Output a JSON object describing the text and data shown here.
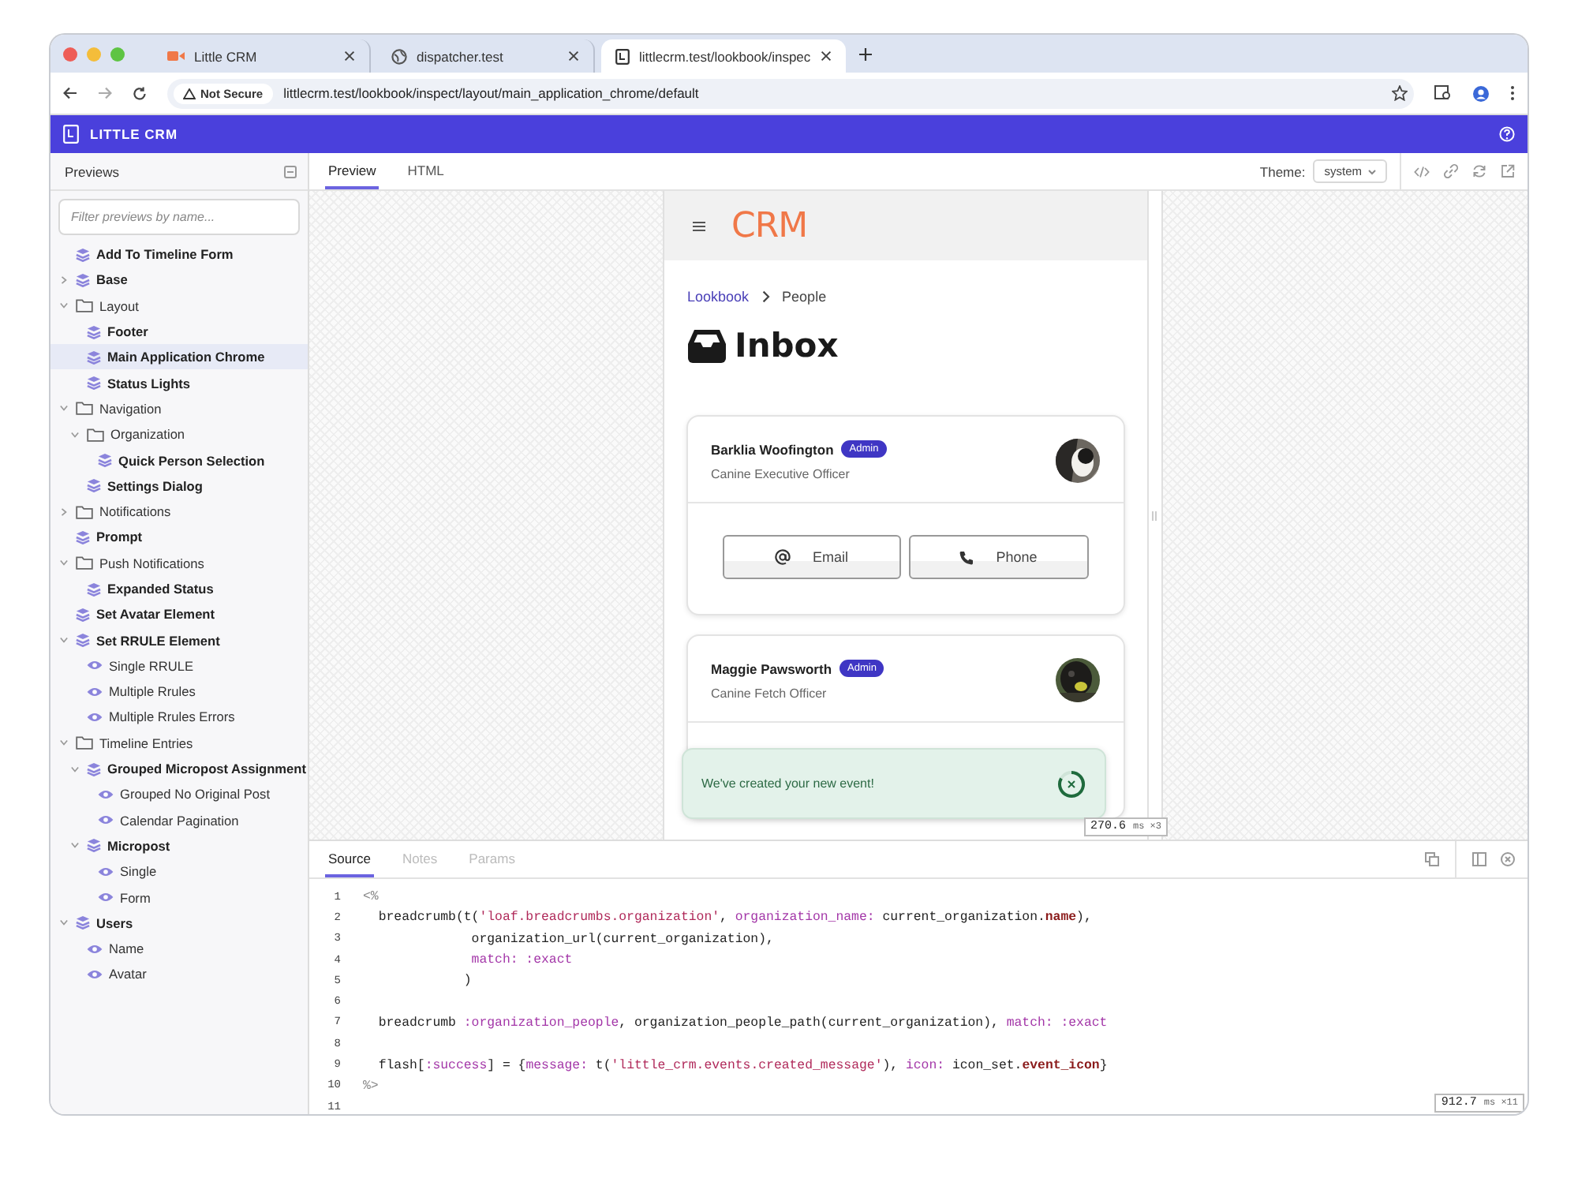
{
  "browser": {
    "tabs": [
      {
        "title": "Little CRM",
        "selected": false
      },
      {
        "title": "dispatcher.test",
        "selected": false
      },
      {
        "title": "littlecrm.test/lookbook/inspec",
        "selected": true
      }
    ],
    "security": "Not Secure",
    "url": "littlecrm.test/lookbook/inspect/layout/main_application_chrome/default"
  },
  "app_header": {
    "title": "LITTLE CRM"
  },
  "sidebar": {
    "title": "Previews",
    "filter": {
      "placeholder": "Filter previews by name..."
    },
    "items": [
      {
        "label": "Add To Timeline Form",
        "kind": "component",
        "selected": false
      },
      {
        "label": "Base",
        "kind": "component",
        "selected": false,
        "expanded": false
      },
      {
        "label": "Layout",
        "kind": "folder",
        "selected": false,
        "expanded": true,
        "children": [
          {
            "label": "Footer",
            "kind": "component",
            "selected": false
          },
          {
            "label": "Main Application Chrome",
            "kind": "component",
            "selected": true
          },
          {
            "label": "Status Lights",
            "kind": "component",
            "selected": false
          }
        ]
      },
      {
        "label": "Navigation",
        "kind": "folder",
        "selected": false,
        "expanded": true,
        "children": [
          {
            "label": "Organization",
            "kind": "folder",
            "selected": false,
            "expanded": true,
            "children": [
              {
                "label": "Quick Person Selection",
                "kind": "component",
                "selected": false
              }
            ]
          },
          {
            "label": "Settings Dialog",
            "kind": "component",
            "selected": false
          }
        ]
      },
      {
        "label": "Notifications",
        "kind": "folder",
        "selected": false,
        "expanded": false
      },
      {
        "label": "Prompt",
        "kind": "component",
        "selected": false
      },
      {
        "label": "Push Notifications",
        "kind": "folder",
        "selected": false,
        "expanded": true,
        "children": [
          {
            "label": "Expanded Status",
            "kind": "component",
            "selected": false
          }
        ]
      },
      {
        "label": "Set Avatar Element",
        "kind": "component",
        "selected": false
      },
      {
        "label": "Set RRULE Element",
        "kind": "component",
        "selected": false,
        "expanded": true,
        "children": [
          {
            "label": "Single RRULE",
            "kind": "preview",
            "selected": false
          },
          {
            "label": "Multiple Rrules",
            "kind": "preview",
            "selected": false
          },
          {
            "label": "Multiple Rrules Errors",
            "kind": "preview",
            "selected": false
          }
        ]
      },
      {
        "label": "Timeline Entries",
        "kind": "folder",
        "selected": false,
        "expanded": true,
        "children": [
          {
            "label": "Grouped Micropost Assignment",
            "kind": "component",
            "selected": false,
            "expanded": true,
            "children": [
              {
                "label": "Grouped No Original Post",
                "kind": "preview",
                "selected": false
              },
              {
                "label": "Calendar Pagination",
                "kind": "preview",
                "selected": false
              }
            ]
          },
          {
            "label": "Micropost",
            "kind": "component",
            "selected": false,
            "expanded": true,
            "children": [
              {
                "label": "Single",
                "kind": "preview",
                "selected": false
              },
              {
                "label": "Form",
                "kind": "preview",
                "selected": false
              }
            ]
          }
        ]
      },
      {
        "label": "Users",
        "kind": "component",
        "selected": false,
        "expanded": true,
        "children": [
          {
            "label": "Name",
            "kind": "preview",
            "selected": false
          },
          {
            "label": "Avatar",
            "kind": "preview",
            "selected": false
          }
        ]
      }
    ]
  },
  "preview_toolbar": {
    "tabs": [
      {
        "label": "Preview",
        "selected": true
      },
      {
        "label": "HTML",
        "selected": false
      }
    ],
    "theme_label": "Theme:",
    "theme_value": "system"
  },
  "preview": {
    "logo": "CRM",
    "breadcrumbs": [
      {
        "label": "Lookbook",
        "kind": "link"
      },
      {
        "label": "People",
        "kind": "current"
      }
    ],
    "heading": "Inbox",
    "people": [
      {
        "name": "Barklia Woofington",
        "badge": "Admin",
        "title": "Canine Executive Officer",
        "buttons": [
          {
            "label": "Email"
          },
          {
            "label": "Phone"
          }
        ]
      },
      {
        "name": "Maggie Pawsworth",
        "badge": "Admin",
        "title": "Canine Fetch Officer"
      }
    ],
    "toast": {
      "message": "We've created your new event!"
    },
    "timing": "270.6",
    "timing_unit": "ms",
    "timing_count": "×3"
  },
  "bottom_panel": {
    "tabs": [
      {
        "label": "Source",
        "selected": true,
        "disabled": false
      },
      {
        "label": "Notes",
        "selected": false,
        "disabled": true
      },
      {
        "label": "Params",
        "selected": false,
        "disabled": true
      }
    ],
    "code": [
      {
        "number": "1",
        "segments": [
          {
            "text": "<%",
            "kind": "tag"
          }
        ]
      },
      {
        "number": "2",
        "segments": [
          {
            "text": "  breadcrumb(t(",
            "kind": "plain"
          },
          {
            "text": "'loaf.breadcrumbs.organization'",
            "kind": "string"
          },
          {
            "text": ", ",
            "kind": "plain"
          },
          {
            "text": "organization_name:",
            "kind": "symbol"
          },
          {
            "text": " current_organization.",
            "kind": "plain"
          },
          {
            "text": "name",
            "kind": "method"
          },
          {
            "text": "),",
            "kind": "plain"
          }
        ]
      },
      {
        "number": "3",
        "segments": [
          {
            "text": "              organization_url(current_organization),",
            "kind": "plain"
          }
        ]
      },
      {
        "number": "4",
        "segments": [
          {
            "text": "              match: :exact",
            "kind": "symbol"
          }
        ]
      },
      {
        "number": "5",
        "segments": [
          {
            "text": "             )",
            "kind": "plain"
          }
        ]
      },
      {
        "number": "6"
      },
      {
        "number": "7",
        "segments": [
          {
            "text": "  breadcrumb ",
            "kind": "plain"
          },
          {
            "text": ":organization_people",
            "kind": "symbol"
          },
          {
            "text": ", organization_people_path(current_organization), ",
            "kind": "plain"
          },
          {
            "text": "match: :exact",
            "kind": "symbol"
          }
        ]
      },
      {
        "number": "8"
      },
      {
        "number": "9",
        "segments": [
          {
            "text": "  flash[",
            "kind": "plain"
          },
          {
            "text": ":success",
            "kind": "symbol"
          },
          {
            "text": "] = {",
            "kind": "plain"
          },
          {
            "text": "message:",
            "kind": "symbol"
          },
          {
            "text": " t(",
            "kind": "plain"
          },
          {
            "text": "'little_crm.events.created_message'",
            "kind": "string"
          },
          {
            "text": "), ",
            "kind": "plain"
          },
          {
            "text": "icon:",
            "kind": "symbol"
          },
          {
            "text": " icon_set.",
            "kind": "plain"
          },
          {
            "text": "event_icon",
            "kind": "method"
          },
          {
            "text": "}",
            "kind": "plain"
          }
        ]
      },
      {
        "number": "10",
        "segments": [
          {
            "text": "%>",
            "kind": "tag"
          }
        ]
      },
      {
        "number": "11"
      }
    ],
    "timing": "912.7",
    "timing_unit": "ms",
    "timing_count": "×11"
  }
}
